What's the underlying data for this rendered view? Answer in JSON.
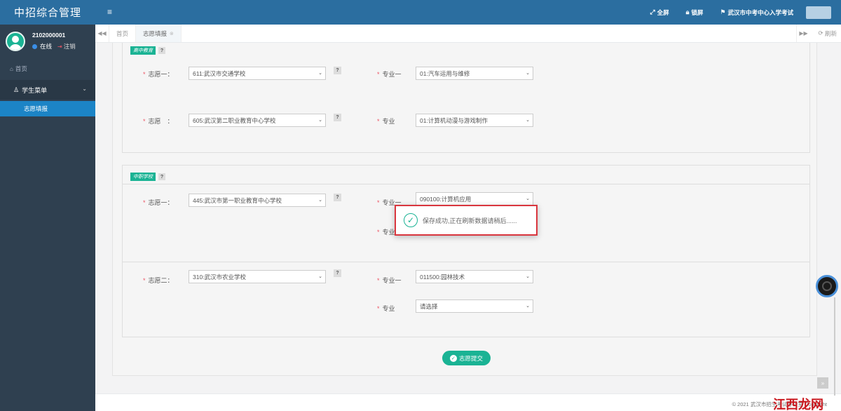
{
  "app": {
    "title": "中招综合管理"
  },
  "user": {
    "id": "2102000001",
    "status": "在线",
    "logout": "注销"
  },
  "sidebar": {
    "home": "首页",
    "group": "学生菜单",
    "sub": "志愿填报"
  },
  "topbar": {
    "fullscreen": "全屏",
    "lock": "锁屏",
    "org": "武汉市中考中心入学考试"
  },
  "tabs": [
    {
      "label": "首页"
    },
    {
      "label": "志愿填报"
    }
  ],
  "refresh": "刷新",
  "sections": [
    {
      "label": "高中教育",
      "rows": [
        {
          "label": "志愿一：",
          "school": "611:武汉市交通学校",
          "major_label": "专业一",
          "major": "01:汽车运用与维修"
        },
        {
          "label": "志愿　：",
          "school": "605:武汉第二职业教育中心学校",
          "major_label": "专业",
          "major": "01:计算机动漫与游戏制作"
        }
      ]
    },
    {
      "label": "中职学校",
      "rows": [
        {
          "label": "志愿一：",
          "school": "445:武汉市第一职业教育中心学校",
          "major1_label": "专业一",
          "major1": "090100:计算机应用",
          "major2_label": "专业"
        },
        {
          "label": "志愿二：",
          "school": "310:武汉市农业学校",
          "major1_label": "专业一",
          "major1": "011500:园林技术",
          "major2_label": "专业",
          "major2": "请选择"
        }
      ]
    }
  ],
  "submit": "志愿提交",
  "toast": {
    "message": "保存成功,正在刷新数据请稍后......"
  },
  "footer": {
    "text": "© 2021 武汉市招生考试办公室 Copyright",
    "watermark": "江西龙网"
  },
  "colors": {
    "primary": "#2b6ea0",
    "sidebar": "#2f4050",
    "accent": "#1ab394",
    "toast_border": "#d9363e"
  }
}
